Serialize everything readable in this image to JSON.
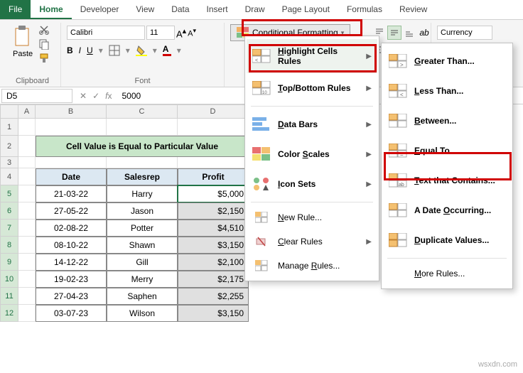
{
  "tabs": {
    "file": "File",
    "home": "Home",
    "developer": "Developer",
    "view": "View",
    "data": "Data",
    "insert": "Insert",
    "draw": "Draw",
    "page_layout": "Page Layout",
    "formulas": "Formulas",
    "review": "Review"
  },
  "ribbon": {
    "clipboard": {
      "paste": "Paste",
      "label": "Clipboard"
    },
    "font": {
      "name": "Calibri",
      "size": "11",
      "label": "Font"
    },
    "cf_button": "Conditional Formatting",
    "number_format": "Currency"
  },
  "namebox": "D5",
  "formula": "5000",
  "title_cell": "Cell Value is Equal to Particular Value",
  "headers": {
    "date": "Date",
    "salesrep": "Salesrep",
    "profit": "Profit"
  },
  "rows": [
    {
      "date": "21-03-22",
      "rep": "Harry",
      "profit": "$5,000"
    },
    {
      "date": "27-05-22",
      "rep": "Jason",
      "profit": "$2,150"
    },
    {
      "date": "02-08-22",
      "rep": "Potter",
      "profit": "$4,510"
    },
    {
      "date": "08-10-22",
      "rep": "Shawn",
      "profit": "$3,150"
    },
    {
      "date": "14-12-22",
      "rep": "Gill",
      "profit": "$2,100"
    },
    {
      "date": "19-02-23",
      "rep": "Merry",
      "profit": "$2,175"
    },
    {
      "date": "27-04-23",
      "rep": "Saphen",
      "profit": "$2,255"
    },
    {
      "date": "03-07-23",
      "rep": "Wilson",
      "profit": "$3,150"
    }
  ],
  "menu1": {
    "highlight": "Highlight Cells Rules",
    "topbottom": "Top/Bottom Rules",
    "databars": "Data Bars",
    "colorscales": "Color Scales",
    "iconsets": "Icon Sets",
    "newrule": "New Rule...",
    "clear": "Clear Rules",
    "manage": "Manage Rules..."
  },
  "menu2": {
    "greater": "Greater Than...",
    "less": "Less Than...",
    "between": "Between...",
    "equal": "Equal To...",
    "text": "Text that Contains...",
    "date": "A Date Occurring...",
    "dup": "Duplicate Values...",
    "more": "More Rules..."
  },
  "watermark": "wsxdn.com"
}
